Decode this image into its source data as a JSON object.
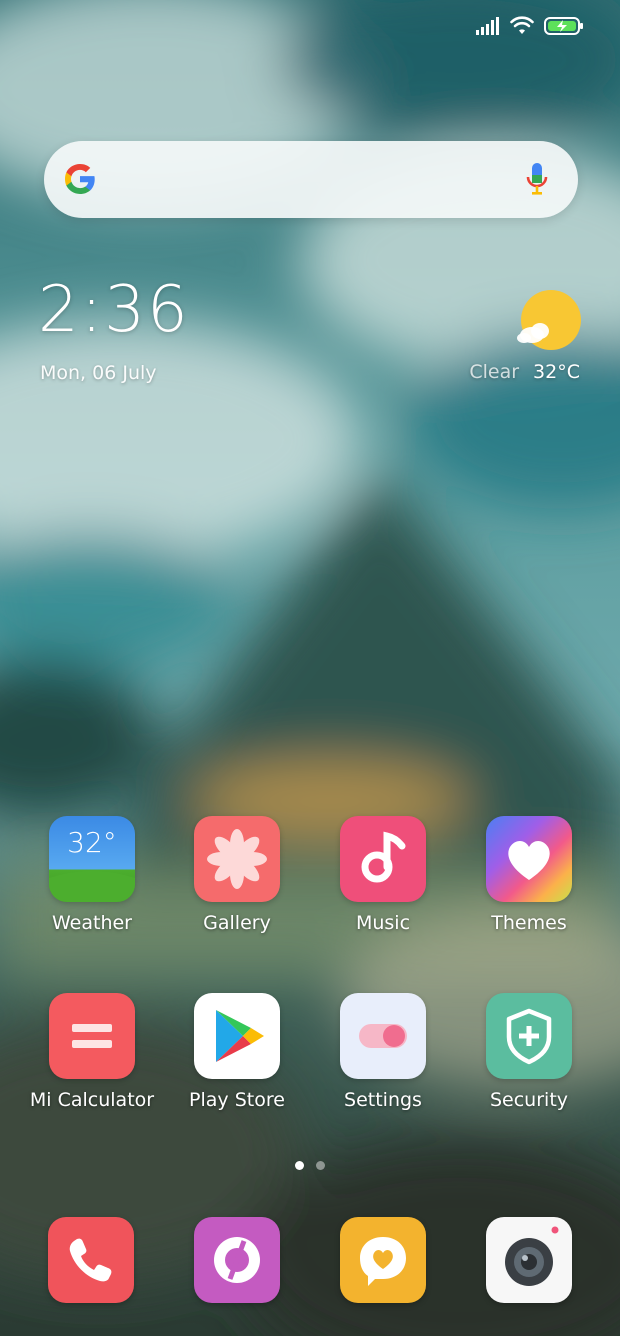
{
  "status": {
    "icons": [
      "signal-icon",
      "wifi-icon",
      "battery-charging-icon"
    ]
  },
  "search": {
    "logo": "google-g-logo",
    "mic_icon": "mic-icon"
  },
  "clock": {
    "time": "2:36",
    "date": "Mon, 06 July"
  },
  "weather_widget": {
    "condition": "Clear",
    "temperature": "32°C",
    "icon": "sun-cloud-icon"
  },
  "apps": [
    {
      "label": "Weather",
      "icon": "weather-icon",
      "icon_text": "32°"
    },
    {
      "label": "Gallery",
      "icon": "flower-icon"
    },
    {
      "label": "Music",
      "icon": "music-note-icon"
    },
    {
      "label": "Themes",
      "icon": "heart-icon"
    },
    {
      "label": "Mi Calculator",
      "icon": "equals-icon"
    },
    {
      "label": "Play Store",
      "icon": "play-triangle-icon"
    },
    {
      "label": "Settings",
      "icon": "toggle-icon"
    },
    {
      "label": "Security",
      "icon": "shield-plus-icon"
    }
  ],
  "page_indicator": {
    "current": 1,
    "total": 2
  },
  "dock": [
    {
      "icon": "phone-icon"
    },
    {
      "icon": "browser-icon"
    },
    {
      "icon": "message-heart-icon"
    },
    {
      "icon": "camera-icon"
    }
  ],
  "colors": {
    "weather_top": "#3f8ee6",
    "weather_grass": "#4cae2e",
    "gallery": "#f56b6c",
    "music": "#ef4f7a",
    "calculator": "#f45a5f",
    "settings_bg": "#e8eefb",
    "settings_toggle": "#f06d8f",
    "security": "#5bbd9f",
    "phone": "#f0545b",
    "browser": "#c45bc1",
    "messages": "#f3b32e",
    "camera": "#f7f7f7"
  }
}
